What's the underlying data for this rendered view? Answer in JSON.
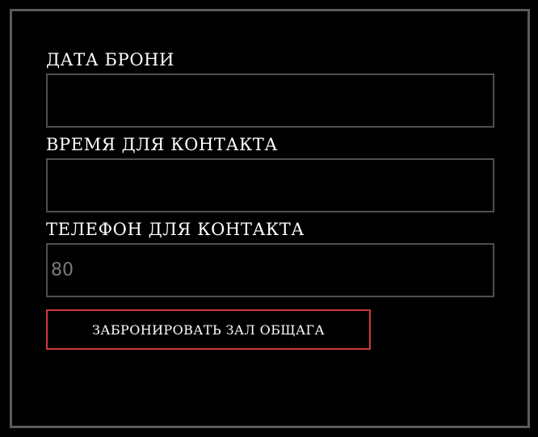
{
  "form": {
    "date_label": "ДАТА БРОНИ",
    "date_value": "",
    "time_label": "ВРЕМЯ ДЛЯ КОНТАКТА",
    "time_value": "",
    "phone_label": "ТЕЛЕФОН ДЛЯ КОНТАКТА",
    "phone_placeholder": "80",
    "phone_value": "",
    "submit_label": "ЗАБРОНИРОВАТЬ ЗАЛ ОБЩАГА"
  },
  "colors": {
    "background": "#000000",
    "frame_border": "#5a5a5a",
    "field_border": "#4f4f4f",
    "button_border": "#d0393d",
    "text": "#ffffff",
    "placeholder": "#7a7a7a"
  }
}
